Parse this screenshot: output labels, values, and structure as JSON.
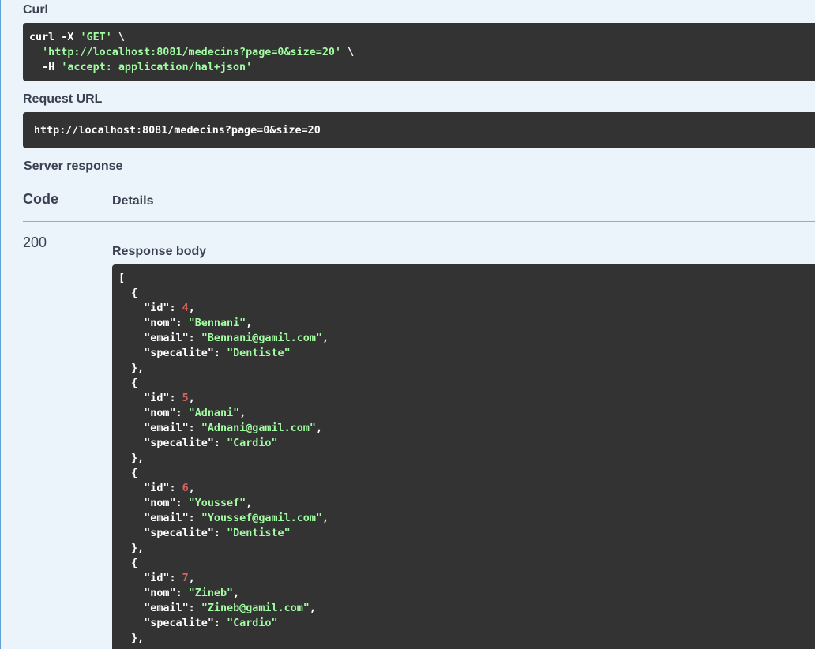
{
  "curl": {
    "heading": "Curl",
    "lines": [
      [
        {
          "t": "curl -X ",
          "c": "plain"
        },
        {
          "t": "'GET'",
          "c": "str"
        },
        {
          "t": " \\",
          "c": "plain"
        }
      ],
      [
        {
          "t": "  ",
          "c": "plain"
        },
        {
          "t": "'http://localhost:8081/medecins?page=0&size=20'",
          "c": "str"
        },
        {
          "t": " \\",
          "c": "plain"
        }
      ],
      [
        {
          "t": "  -H ",
          "c": "plain"
        },
        {
          "t": "'accept: application/hal+json'",
          "c": "str"
        }
      ]
    ]
  },
  "request_url": {
    "heading": "Request URL",
    "value": "http://localhost:8081/medecins?page=0&size=20"
  },
  "server_response": {
    "heading": "Server response",
    "code_header": "Code",
    "details_header": "Details",
    "status_code": "200",
    "response_body_heading": "Response body"
  },
  "response_body": [
    {
      "id": 4,
      "nom": "Bennani",
      "email": "Bennani@gamil.com",
      "specalite": "Dentiste"
    },
    {
      "id": 5,
      "nom": "Adnani",
      "email": "Adnani@gamil.com",
      "specalite": "Cardio"
    },
    {
      "id": 6,
      "nom": "Youssef",
      "email": "Youssef@gamil.com",
      "specalite": "Dentiste"
    },
    {
      "id": 7,
      "nom": "Zineb",
      "email": "Zineb@gamil.com",
      "specalite": "Cardio"
    }
  ],
  "colors": {
    "background": "#ebf3fb",
    "code_background": "#333333",
    "string": "#a2fca2",
    "number": "#d36363"
  }
}
